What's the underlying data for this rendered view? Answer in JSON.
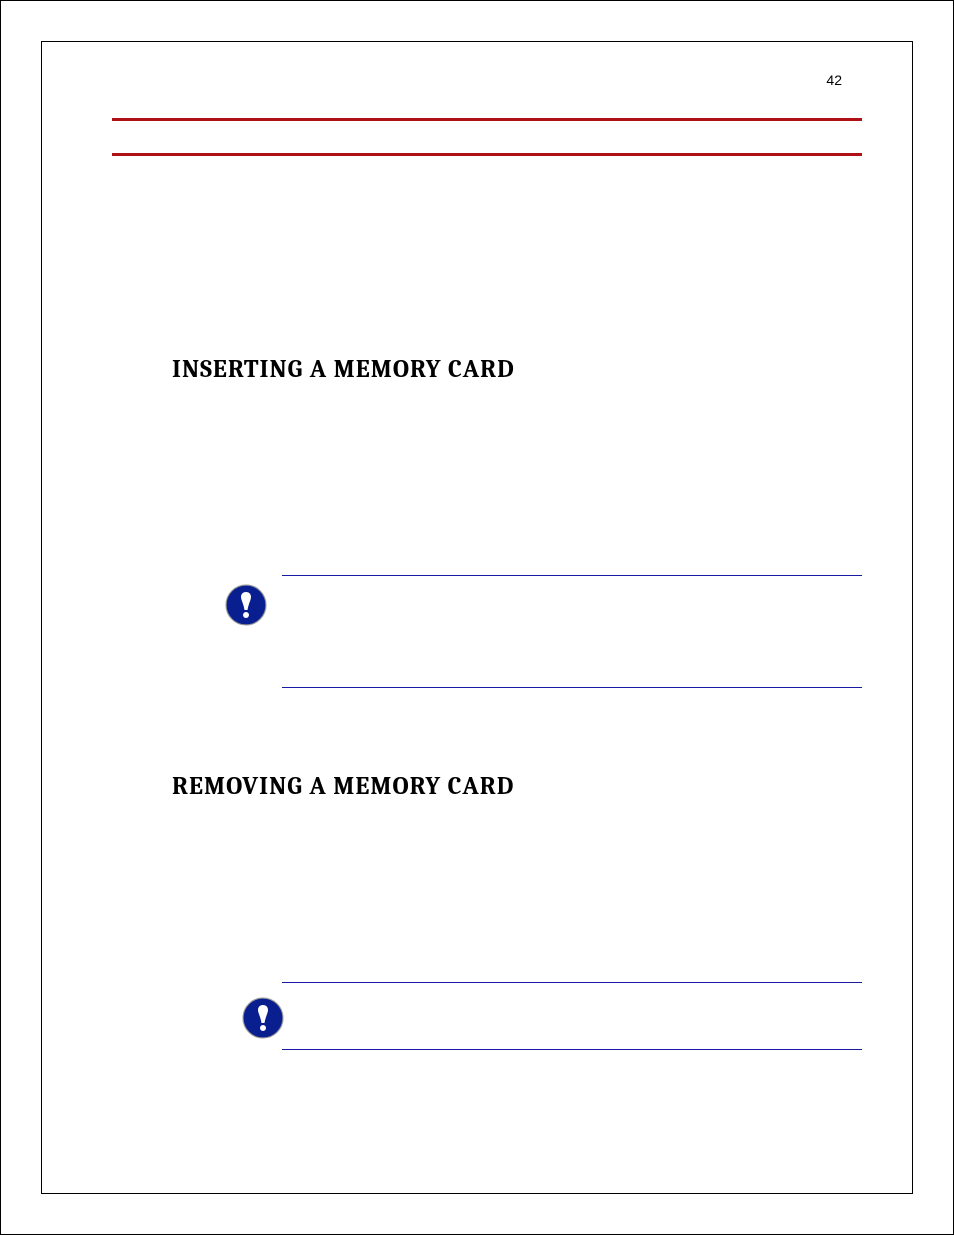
{
  "page_number": "42",
  "headings": {
    "inserting": "INSERTING A MEMORY CARD",
    "removing": "REMOVING A MEMORY CARD"
  },
  "icons": {
    "note1": "notice-exclamation-icon",
    "note2": "notice-exclamation-icon"
  },
  "colors": {
    "rule": "#b01116",
    "note_border": "#1a1aa6",
    "icon_fill": "#0a1f8f"
  }
}
